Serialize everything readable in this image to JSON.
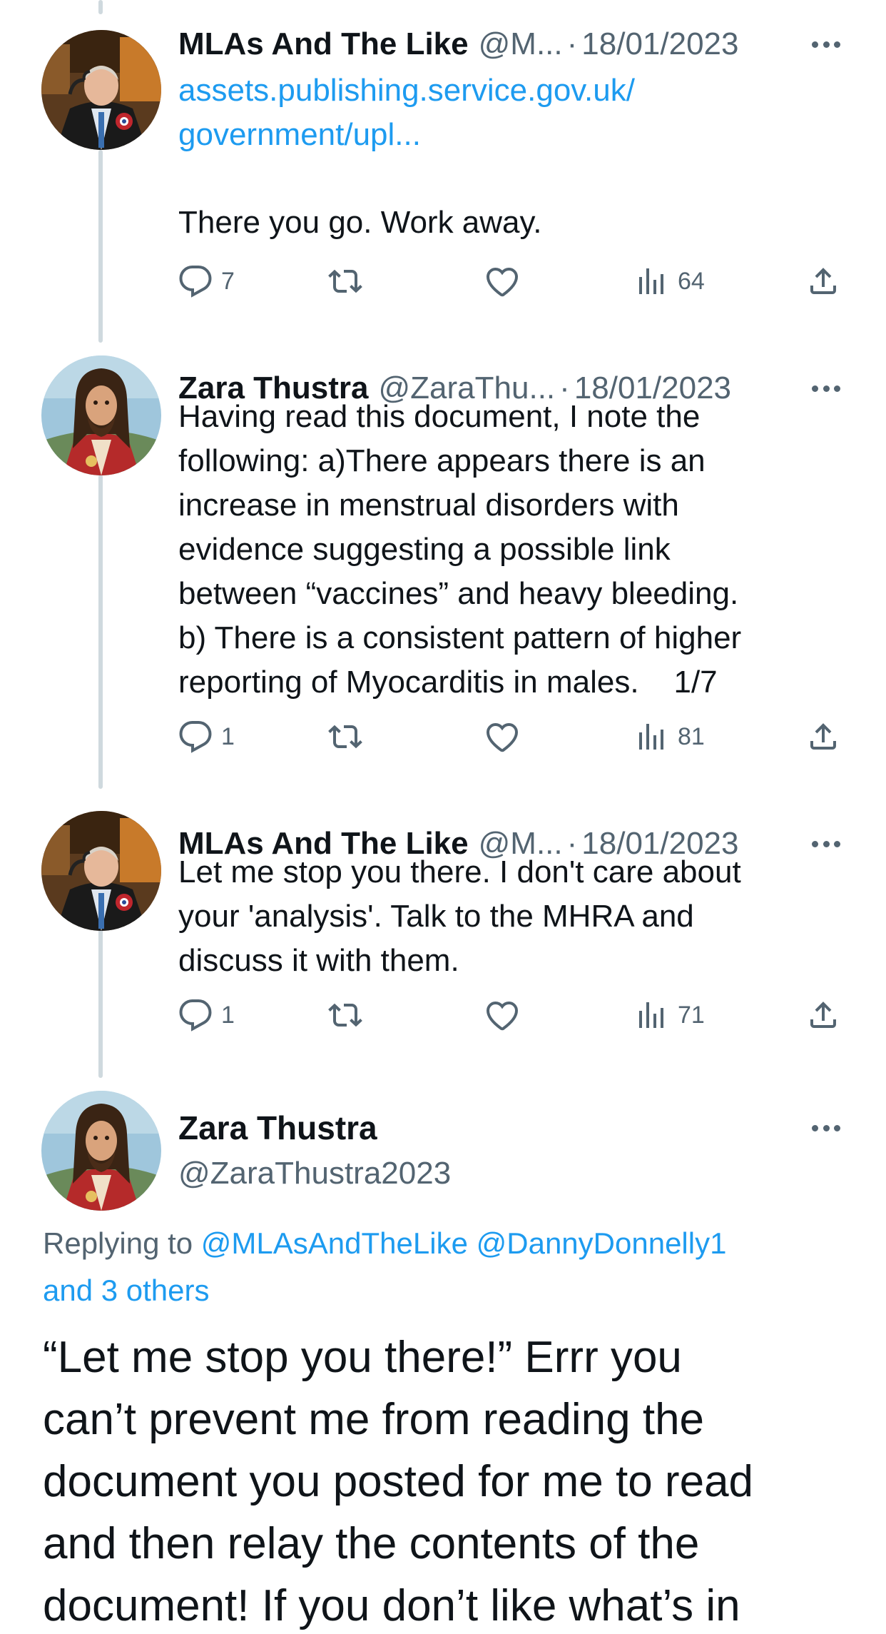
{
  "tweets": [
    {
      "name": "MLAs And The Like",
      "handle": "@M...",
      "separator": "·",
      "date": "18/01/2023",
      "link_lines": [
        "assets.publishing.service.gov.uk/",
        "government/upl..."
      ],
      "text_lines": [
        "There you go. Work away."
      ],
      "replies": "7",
      "views": "64"
    },
    {
      "name": "Zara Thustra",
      "handle": "@ZaraThu...",
      "separator": "·",
      "date": "18/01/2023",
      "text_lines": [
        "Having read this document, I note the",
        "following: a)There appears there is an",
        "increase in menstrual disorders with",
        "evidence suggesting a possible link",
        "between “vaccines” and heavy bleeding.",
        "b) There is a consistent pattern of higher",
        "reporting of Myocarditis in males.    1/7"
      ],
      "replies": "1",
      "views": "81"
    },
    {
      "name": "MLAs And The Like",
      "handle": "@M...",
      "separator": "·",
      "date": "18/01/2023",
      "text_lines": [
        "Let me stop you there. I don't care about",
        "your 'analysis'. Talk to the MHRA and",
        "discuss it with them."
      ],
      "replies": "1",
      "views": "71"
    }
  ],
  "main_tweet": {
    "name": "Zara Thustra",
    "handle": "@ZaraThustra2023",
    "replying_prefix": "Replying to",
    "mention_1": "@MLAsAndTheLike",
    "mention_2": "@DannyDonnelly1",
    "others": "and 3 others",
    "text_lines": [
      "“Let me stop you there!” Errr you",
      "can’t prevent me from reading the",
      "document you posted for me to read",
      "and then relay the contents of the",
      "document! If you don’t like what’s in"
    ]
  },
  "colors": {
    "link": "#1d9bf0",
    "secondary_text": "#536471",
    "thread_line": "#cfd9de"
  },
  "icons": [
    "reply-icon",
    "retweet-icon",
    "like-icon",
    "views-icon",
    "share-icon",
    "more-icon"
  ]
}
